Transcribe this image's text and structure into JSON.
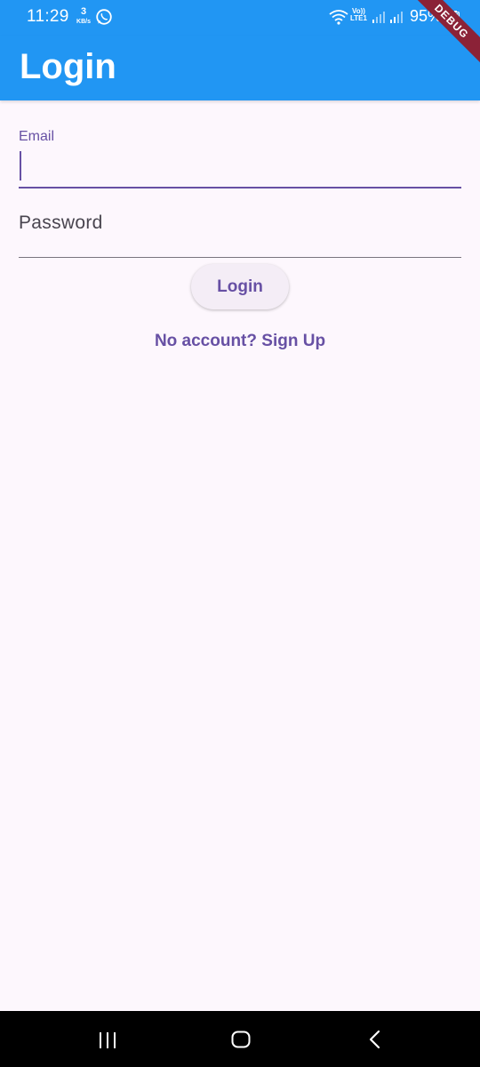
{
  "status_bar": {
    "time": "11:29",
    "net_speed_value": "3",
    "net_speed_unit": "KB/s",
    "volte_line1": "Vo))",
    "volte_line2": "LTE1",
    "battery": "95%",
    "icons": [
      "whatsapp-icon",
      "wifi-icon",
      "signal-icon",
      "signal-icon",
      "battery-icon"
    ]
  },
  "app_bar": {
    "title": "Login",
    "debug_banner": "DEBUG",
    "color": "#2196f3"
  },
  "form": {
    "email_label": "Email",
    "email_value": "",
    "password_label": "Password",
    "password_value": "",
    "login_button": "Login",
    "signup_link": "No account? Sign Up"
  },
  "nav_bar": {
    "icons": [
      "recents-icon",
      "home-icon",
      "back-icon"
    ]
  },
  "colors": {
    "primary": "#6750a4",
    "background": "#fdf7fd",
    "app_bar": "#2196f3"
  }
}
